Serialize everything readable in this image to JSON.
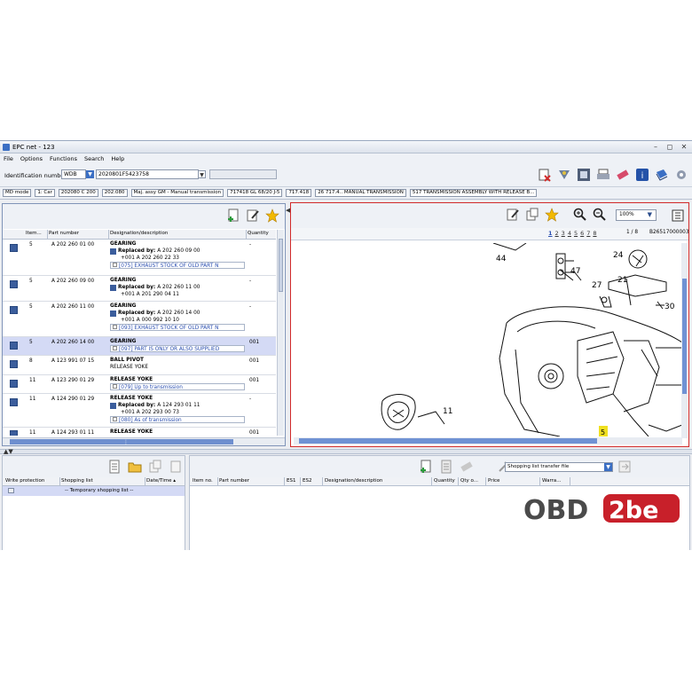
{
  "window": {
    "title": "EPC net - 123"
  },
  "menu": [
    "File",
    "Options",
    "Functions",
    "Search",
    "Help"
  ],
  "identification": {
    "label": "Identification number",
    "prefix": "WDB",
    "value": "2020801F5423758"
  },
  "breadcrumbs": [
    "MD mode",
    "1: Car",
    "202080 C 200",
    "202.080",
    "Maj. assy GM - Manual transmission",
    "717418 GL 68/20 J-5",
    "717.418",
    "26 717.4.. MANUAL TRANSMISSION",
    "517 TRANSMISSION ASSEMBLY WITH RELEASE B..."
  ],
  "parts_table": {
    "columns": [
      "Item...",
      "Part number",
      "Designation/description",
      "Quantity"
    ],
    "rows": [
      {
        "item": "5",
        "part": "A 202 260 01 00",
        "name": "GEARING",
        "replaced": "A 202 260 09 00",
        "plus": "+001 A 202 260 22 33",
        "note": "[075] EXHAUST STOCK OF OLD PART N",
        "qty": "-"
      },
      {
        "item": "5",
        "part": "A 202 260 09 00",
        "name": "GEARING",
        "replaced": "A 202 260 11 00",
        "plus": "+001 A 201 290 04 11",
        "note": "",
        "qty": "-"
      },
      {
        "item": "5",
        "part": "A 202 260 11 00",
        "name": "GEARING",
        "replaced": "A 202 260 14 00",
        "plus": "+001 A 000 992 10 10",
        "note": "[093] EXHAUST STOCK OF OLD PART N",
        "qty": "-"
      },
      {
        "item": "5",
        "part": "A 202 260 14 00",
        "name": "GEARING",
        "replaced": "",
        "plus": "",
        "note": "[097] PART IS ONLY OR ALSO SUPPLIED",
        "qty": "001"
      },
      {
        "item": "8",
        "part": "A 123 991 07 15",
        "name": "BALL PIVOT",
        "sub": "RELEASE YOKE",
        "note": "",
        "qty": "001"
      },
      {
        "item": "11",
        "part": "A 123 290 01 29",
        "name": "RELEASE YOKE",
        "note": "[079] Up to transmission",
        "qty": "001"
      },
      {
        "item": "11",
        "part": "A 124 290 01 29",
        "name": "RELEASE YOKE",
        "replaced": "A 124 293 01 11",
        "plus": "+001 A 202 293 00 73",
        "note": "[080] As of transmission",
        "qty": "-"
      },
      {
        "item": "11",
        "part": "A 124 293 01 11",
        "name": "RELEASE YOKE",
        "note": "",
        "qty": "001"
      }
    ],
    "replaced_label": "Replaced by:"
  },
  "drawing": {
    "zoom": "100%",
    "pages": [
      "1",
      "2",
      "3",
      "4",
      "5",
      "6",
      "7",
      "8"
    ],
    "current_page": "1",
    "page_indicator": "1 / 8",
    "image_id": "B26517000003",
    "callouts": [
      "44",
      "47",
      "24",
      "27",
      "21",
      "30",
      "11",
      "5"
    ]
  },
  "shopping_lists": {
    "columns": [
      "Write protection",
      "Shopping list",
      "Date/Time ▴"
    ],
    "row": "-- Temporary shopping list --"
  },
  "shopping_items": {
    "transfer_label": "Shopping list transfer file",
    "columns": [
      "Item no.",
      "Part number",
      "ES1",
      "ES2",
      "Designation/description",
      "Quantity",
      "Qty o...",
      "Price",
      "Warra..."
    ]
  },
  "watermark": {
    "left": "OBD",
    "right": "2be"
  },
  "colors": {
    "accent": "#3b5d9c",
    "selection": "#d4daf5",
    "highlight_border": "#d12a2a"
  }
}
